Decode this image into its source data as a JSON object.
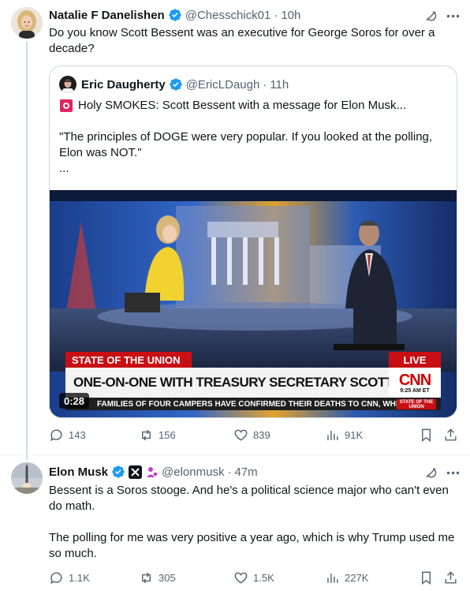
{
  "tweet1": {
    "display_name": "Natalie F Danelishen",
    "handle": "@Chesschick01",
    "time": "10h",
    "text": "Do you know Scott Bessent was an executive for George Soros for over a decade?",
    "quote": {
      "display_name": "Eric Daugherty",
      "handle": "@EricLDaugh",
      "time": "11h",
      "line1": "Holy SMOKES: Scott Bessent with a message for Elon Musk...",
      "line2": "\"The principles of DOGE were very popular. If you looked at the polling, Elon was NOT.\"",
      "line3": "...",
      "video": {
        "chyron_top": "STATE OF THE UNION",
        "chyron_main": "ONE-ON-ONE WITH TREASURY SECRETARY SCOTT BESSENT",
        "ticker": "FAMILIES OF FOUR CAMPERS HAVE CONFIRMED THEIR DEATHS TO CNN, WHILE",
        "live": "LIVE",
        "network": "CNN",
        "clock": "9:25 AM ET",
        "program_badge": "STATE OF THE UNION",
        "duration": "0:28"
      }
    },
    "stats": {
      "replies": "143",
      "reposts": "156",
      "likes": "839",
      "views": "91K"
    }
  },
  "tweet2": {
    "display_name": "Elon Musk",
    "handle": "@elonmusk",
    "time": "47m",
    "text1": "Bessent is a Soros stooge. And he's a political science major who can't even do math.",
    "text2": "The polling for me was very positive a year ago, which is why Trump used me so much.",
    "stats": {
      "replies": "1.1K",
      "reposts": "305",
      "likes": "1.5K",
      "views": "227K"
    }
  },
  "colors": {
    "verified": "#1d9bf0",
    "muted": "#536471",
    "border": "#cfd9de",
    "alert": "#e0245e",
    "cnn_red": "#cc0000"
  },
  "icons": [
    "verified-badge-icon",
    "grok-icon",
    "more-icon",
    "reply-icon",
    "repost-icon",
    "like-icon",
    "views-icon",
    "bookmark-icon",
    "share-icon",
    "x-logo-icon",
    "person-icon",
    "siren-icon"
  ]
}
